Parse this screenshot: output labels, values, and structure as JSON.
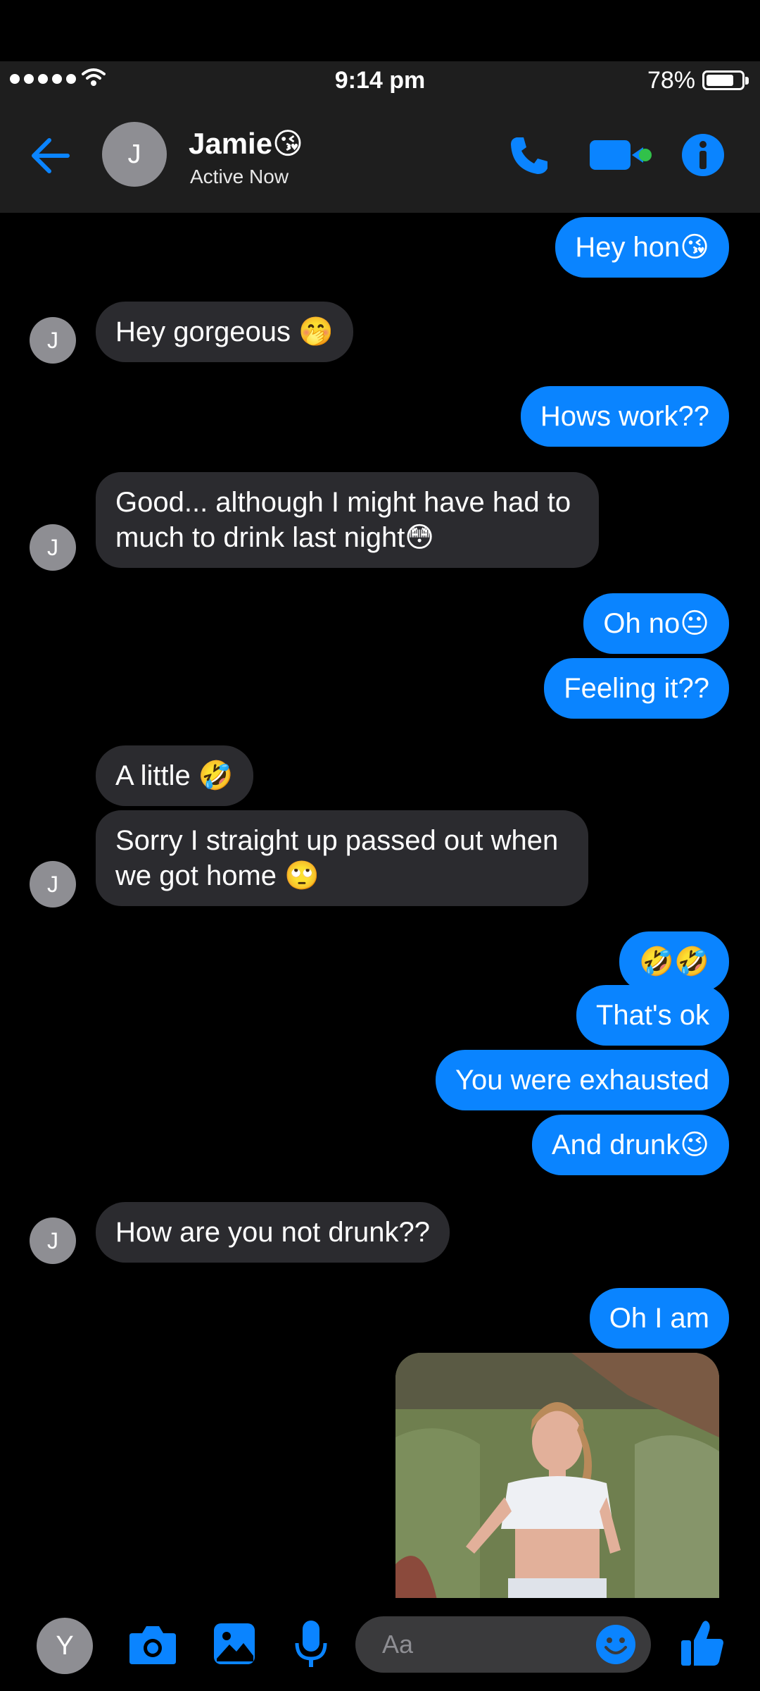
{
  "status_bar": {
    "time": "9:14 pm",
    "battery": "78%"
  },
  "header": {
    "avatar_letter": "J",
    "contact_name": "Jamie😘",
    "contact_status": "Active Now"
  },
  "messages": [
    {
      "from": "me",
      "text": "Hey hon😘"
    },
    {
      "from": "them",
      "text": "Hey gorgeous 🤭"
    },
    {
      "from": "me",
      "text": "Hows work??"
    },
    {
      "from": "them",
      "text": "Good... although I might have had to much to drink last night😳"
    },
    {
      "from": "me",
      "text": "Oh no😐"
    },
    {
      "from": "me",
      "text": "Feeling it??"
    },
    {
      "from": "them",
      "text": "A little 🤣"
    },
    {
      "from": "them",
      "text": "Sorry I straight up passed out when we got home 🙄"
    },
    {
      "from": "me",
      "text": "🤣🤣"
    },
    {
      "from": "me",
      "text": "That's ok"
    },
    {
      "from": "me",
      "text": "You were exhausted"
    },
    {
      "from": "me",
      "text": "And drunk😉"
    },
    {
      "from": "them",
      "text": "How are you not drunk??"
    },
    {
      "from": "me",
      "text": "Oh I am"
    }
  ],
  "composer": {
    "avatar_letter": "Y",
    "placeholder": "Aa"
  },
  "colors": {
    "accent": "#0a84ff",
    "incoming_bubble": "#2b2b2f",
    "header_bg": "#1e1e1e"
  }
}
